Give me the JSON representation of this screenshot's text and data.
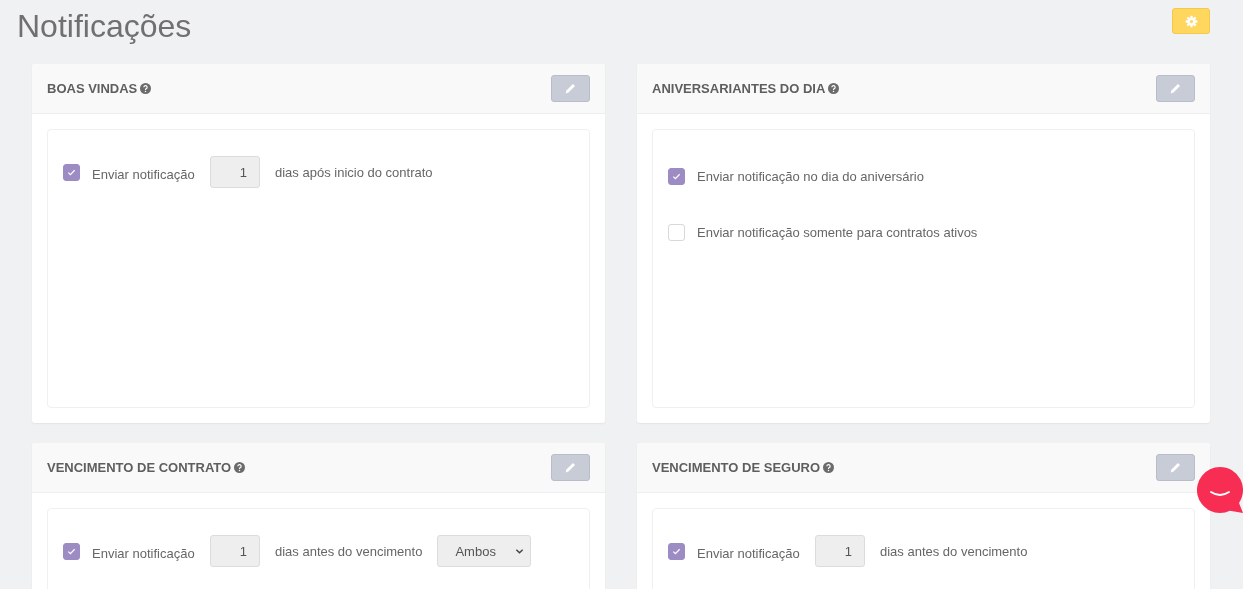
{
  "page": {
    "title": "Notificações"
  },
  "cards": [
    {
      "title": "BOAS VINDAS",
      "rows": [
        {
          "kind": "days",
          "checked": true,
          "label": "Enviar notificação",
          "value": "1",
          "suffix": "dias após inicio do contrato"
        }
      ]
    },
    {
      "title": "ANIVERSARIANTES DO DIA",
      "rows": [
        {
          "kind": "check",
          "checked": true,
          "label": "Enviar notificação no dia do aniversário"
        },
        {
          "kind": "check",
          "checked": false,
          "label": "Enviar notificação somente para contratos ativos"
        }
      ]
    },
    {
      "title": "VENCIMENTO DE CONTRATO",
      "rows": [
        {
          "kind": "days",
          "checked": true,
          "label": "Enviar notificação",
          "value": "1",
          "suffix": "dias antes do vencimento",
          "select": "Ambos"
        }
      ]
    },
    {
      "title": "VENCIMENTO DE SEGURO",
      "rows": [
        {
          "kind": "days",
          "checked": true,
          "label": "Enviar notificação",
          "value": "1",
          "suffix": "dias antes do vencimento"
        }
      ]
    }
  ]
}
